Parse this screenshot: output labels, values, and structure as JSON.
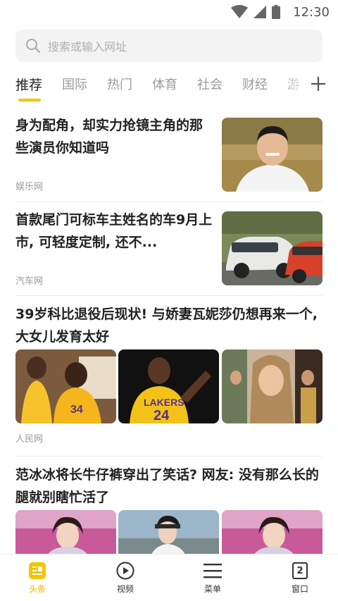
{
  "status": {
    "time": "12:30"
  },
  "search": {
    "placeholder": "搜索或输入网址"
  },
  "tabs": [
    {
      "label": "推荐",
      "active": true
    },
    {
      "label": "国际"
    },
    {
      "label": "热门"
    },
    {
      "label": "体育"
    },
    {
      "label": "社会"
    },
    {
      "label": "财经"
    },
    {
      "label": "游"
    }
  ],
  "feed": [
    {
      "title": "身为配角，却实力抢镜主角的那些演员你知道吗",
      "source": "娱乐网"
    },
    {
      "title": "首款尾门可标车主姓名的车9月上市, 可轻度定制, 还不...",
      "source": "汽车网"
    },
    {
      "title": "39岁科比退役后现状! 与娇妻瓦妮莎仍想再来一个, 大女儿发育太好",
      "source": "人民网"
    },
    {
      "title": "范冰冰将长牛仔裤穿出了笑话? 网友: 没有那么长的腿就别瞎忙活了"
    }
  ],
  "bottom_nav": [
    {
      "label": "头条",
      "active": true
    },
    {
      "label": "视频"
    },
    {
      "label": "菜单"
    },
    {
      "label": "窗口",
      "badge": "2"
    }
  ],
  "colors": {
    "accent": "#f5c400"
  }
}
